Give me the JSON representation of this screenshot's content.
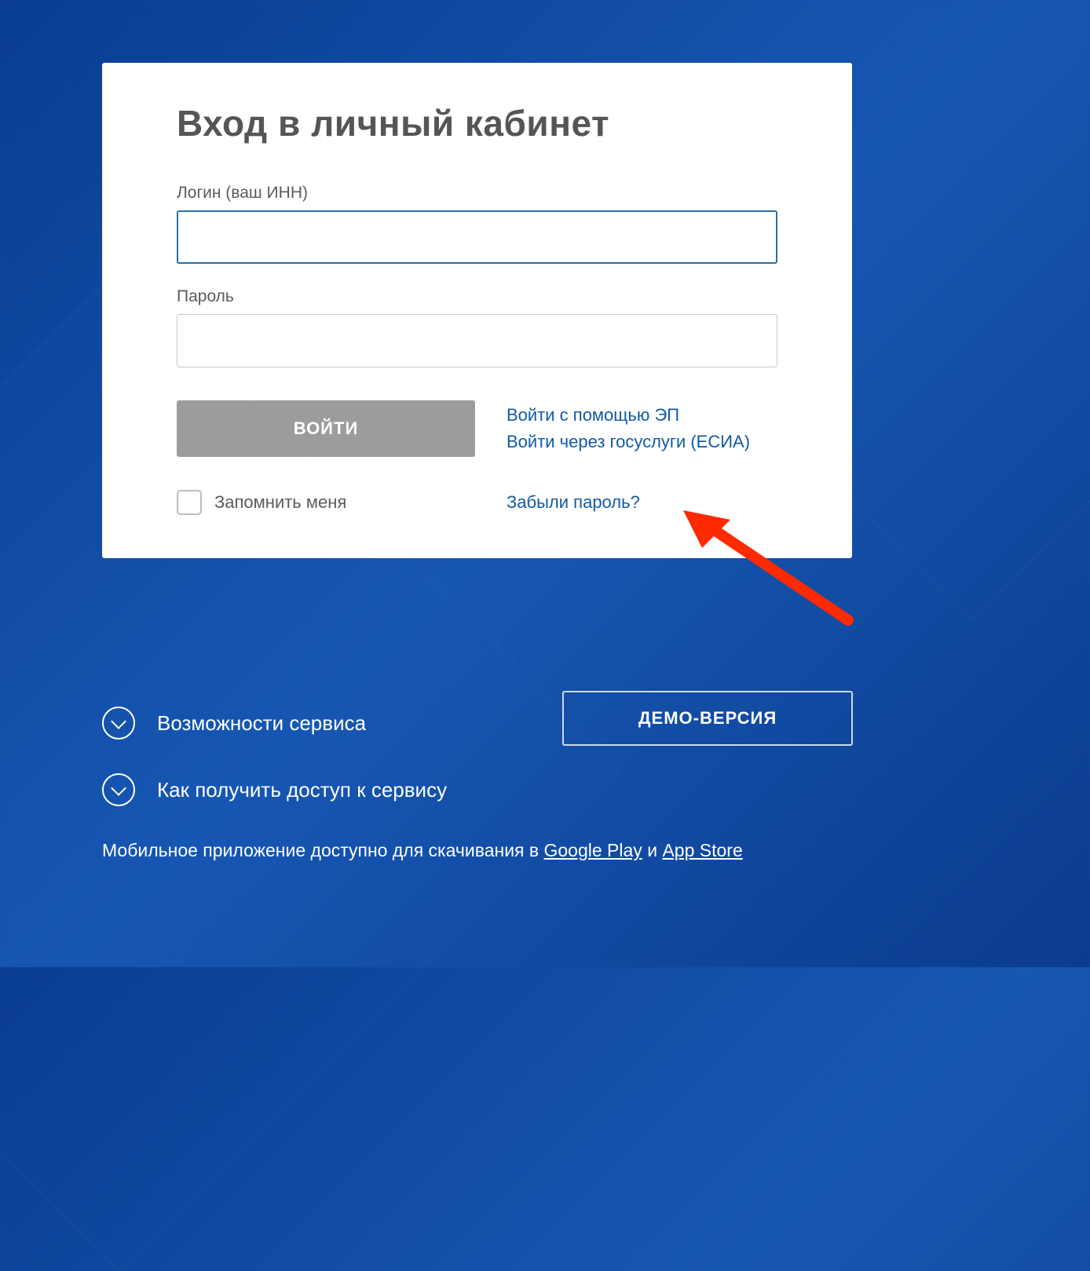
{
  "card": {
    "title": "Вход в личный кабинет",
    "login_label": "Логин (ваш ИНН)",
    "login_value": "",
    "password_label": "Пароль",
    "password_value": "",
    "submit_label": "ВОЙТИ",
    "alt_ep": "Войти с помощью ЭП",
    "alt_esia": "Войти через госуслуги (ЕСИА)",
    "remember_label": "Запомнить меня",
    "forgot_label": "Забыли пароль?"
  },
  "below": {
    "expand_features": "Возможности сервиса",
    "expand_access": "Как получить доступ к сервису",
    "demo_label": "ДЕМО-ВЕРСИЯ"
  },
  "apps": {
    "prefix": "Мобильное приложение доступно для скачивания в ",
    "google": "Google Play",
    "between": " и ",
    "apple": "App Store"
  },
  "annotation": {
    "arrow_color": "#ff2a00"
  }
}
